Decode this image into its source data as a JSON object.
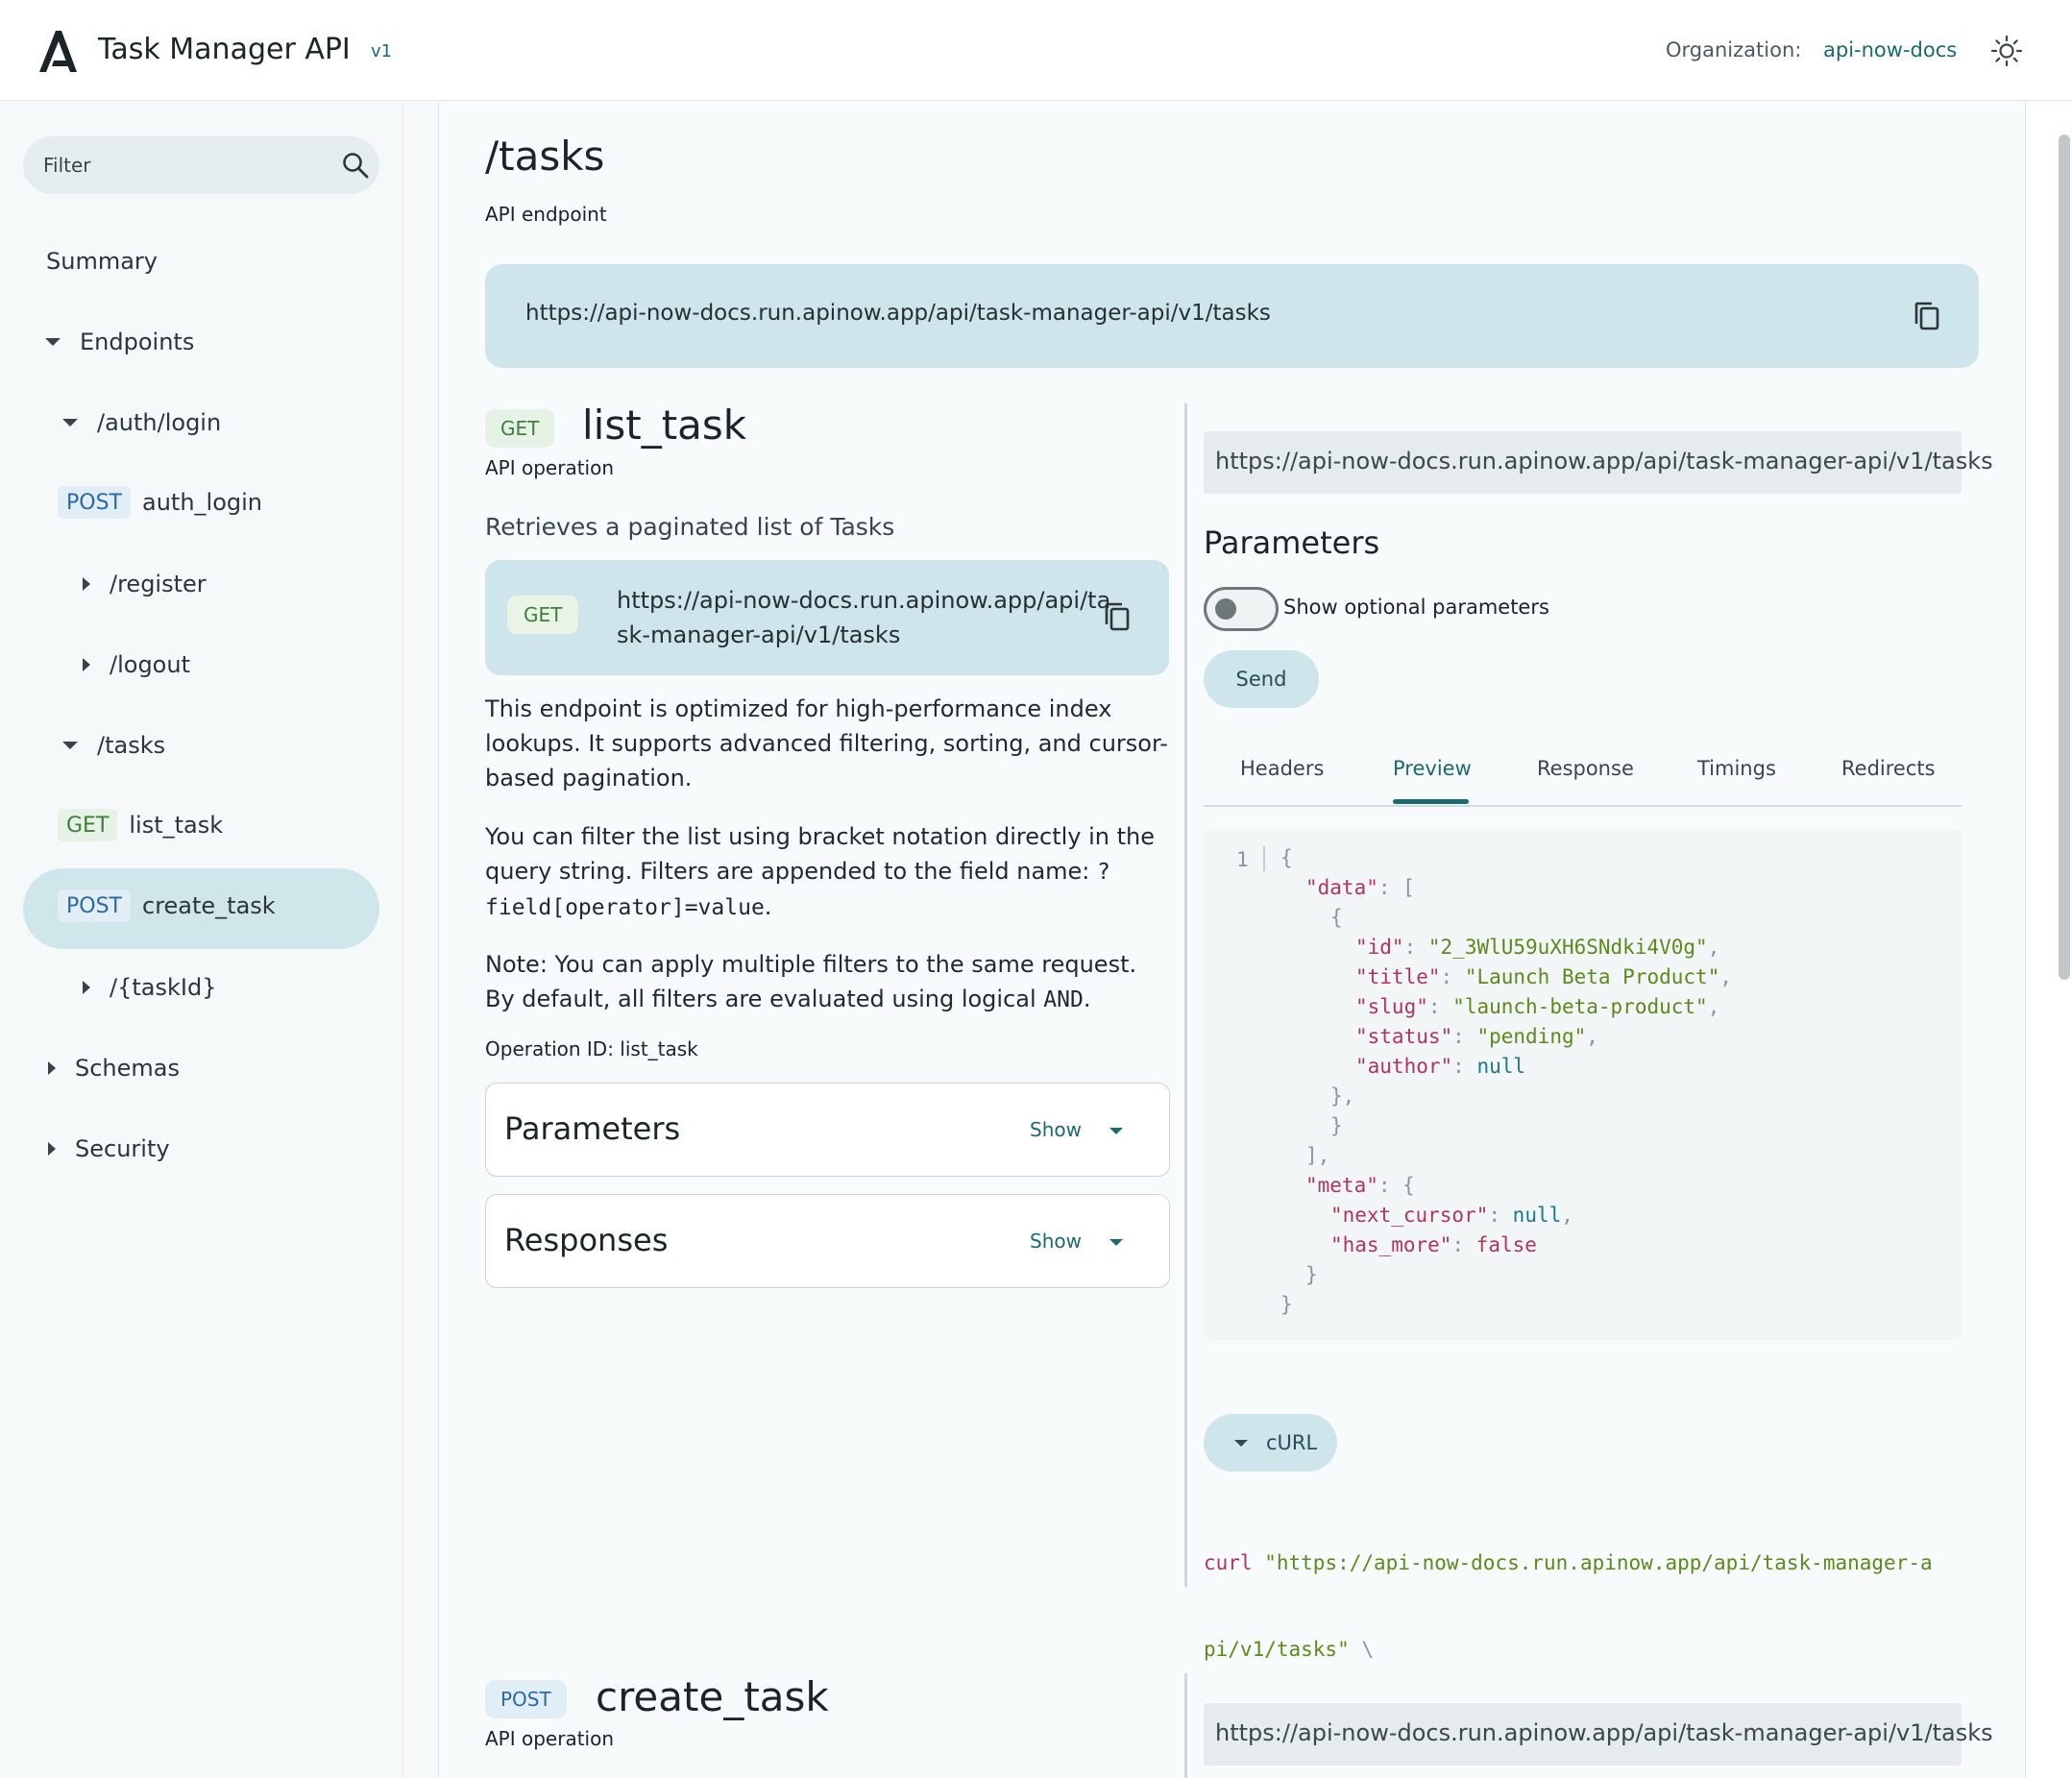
{
  "header": {
    "title": "Task Manager API",
    "version": "v1",
    "org_label": "Organization:",
    "org_value": "api-now-docs"
  },
  "sidebar": {
    "filter_placeholder": "Filter",
    "items": [
      {
        "label": "Summary"
      },
      {
        "label": "Endpoints"
      },
      {
        "label": "/auth/login"
      },
      {
        "method": "POST",
        "label": "auth_login"
      },
      {
        "label": "/register"
      },
      {
        "label": "/logout"
      },
      {
        "label": "/tasks"
      },
      {
        "method": "GET",
        "label": "list_task"
      },
      {
        "method": "POST",
        "label": "create_task"
      },
      {
        "label": "/{taskId}"
      },
      {
        "label": "Schemas"
      },
      {
        "label": "Security"
      }
    ]
  },
  "main": {
    "path_title": "/tasks",
    "path_subtitle": "API endpoint",
    "endpoint_url": "https://api-now-docs.run.apinow.app/api/task-manager-api/v1/tasks",
    "operation": {
      "method": "GET",
      "name": "list_task",
      "subtitle": "API operation",
      "summary": "Retrieves a paginated list of Tasks",
      "card_method": "GET",
      "card_url_line1": "https://api-now-docs.run.apinow.app/api/ta",
      "card_url_line2": "sk-manager-api/v1/tasks",
      "para1": "This endpoint is optimized for high-performance index lookups. It supports advanced filtering, sorting, and cursor-based pagination.",
      "para2_pre": "You can filter the list using bracket notation directly in the query string. Filters are appended to the field name: ",
      "para2_code": "?field[operator]=value",
      "para2_post": ".",
      "para3_pre": "Note: You can apply multiple filters to the same request. By default, all filters are evaluated using logical ",
      "para3_code": "AND",
      "para3_post": ".",
      "operation_id": "Operation ID: list_task",
      "parameters_title": "Parameters",
      "responses_title": "Responses",
      "show_label": "Show"
    },
    "next_operation": {
      "method": "POST",
      "name": "create_task",
      "subtitle": "API operation"
    }
  },
  "try_panel": {
    "url": "https://api-now-docs.run.apinow.app/api/task-manager-api/v1/tasks",
    "params_title": "Parameters",
    "toggle_label": "Show optional parameters",
    "toggle_on": false,
    "send_label": "Send",
    "tabs": [
      "Headers",
      "Preview",
      "Response",
      "Timings",
      "Redirects"
    ],
    "active_tab": "Preview",
    "preview": {
      "line_number": "1",
      "id": "2_3WlU59uXH6SNdki4V0g",
      "title": "Launch Beta Product",
      "slug": "launch-beta-product",
      "status": "pending",
      "author": "null",
      "next_cursor": "null",
      "has_more": "false"
    },
    "curl_label": "cURL",
    "curl_cmd": "curl",
    "curl_url_line1": "\"https://api-now-docs.run.apinow.app/api/task-manager-a",
    "curl_url_line2": "pi/v1/tasks\"",
    "curl_cont": "\\",
    "next_url": "https://api-now-docs.run.apinow.app/api/task-manager-api/v1/tasks"
  },
  "colors": {
    "accent": "#1a6a6f",
    "banner": "#cde5eb",
    "get": "#3f7d3a",
    "post": "#2a69a6"
  }
}
